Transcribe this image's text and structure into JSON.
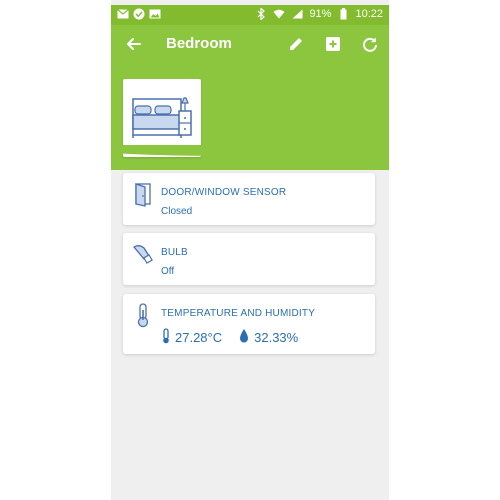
{
  "statusbar": {
    "battery_percent": "91%",
    "time": "10:22",
    "left_icons": [
      "mail-icon",
      "check-circle-icon",
      "image-icon"
    ],
    "right_icons": [
      "bluetooth-icon",
      "wifi-icon",
      "signal-icon",
      "battery-icon"
    ]
  },
  "header": {
    "title": "Bedroom",
    "actions": [
      "edit-icon",
      "add-box-icon",
      "refresh-icon"
    ]
  },
  "colors": {
    "header_green": "#8cc63f",
    "statusbar_green": "#83bb2f",
    "accent_blue": "#2a6fb5",
    "background": "#efefef"
  },
  "devices": [
    {
      "name": "DOOR/WINDOW SENSOR",
      "state": "Closed",
      "icon": "door-icon"
    },
    {
      "name": "BULB",
      "state": "Off",
      "icon": "bulb-icon"
    },
    {
      "name": "TEMPERATURE AND HUMIDITY",
      "temperature": "27.28°C",
      "humidity": "32.33%",
      "icon": "thermometer-icon"
    }
  ]
}
